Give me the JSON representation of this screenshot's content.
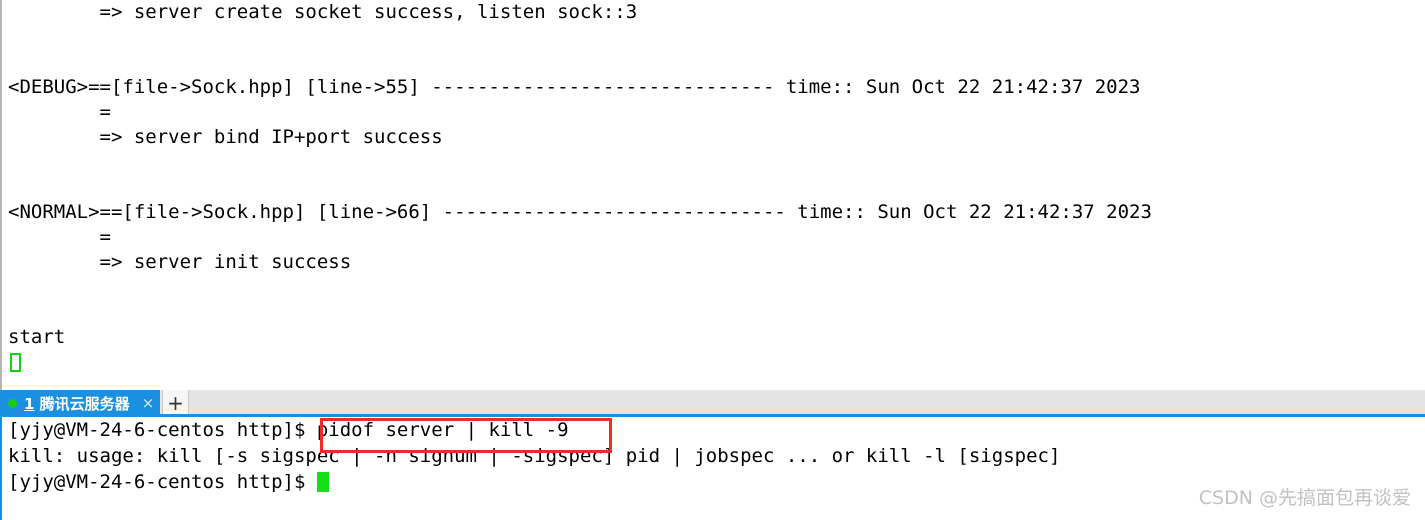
{
  "upper_terminal": {
    "lines": [
      "        => server create socket success, listen sock::3",
      "",
      "",
      "<DEBUG>==[file->Sock.hpp] [line->55] ------------------------------ time:: Sun Oct 22 21:42:37 2023",
      "        =",
      "        => server bind IP+port success",
      "",
      "",
      "<NORMAL>==[file->Sock.hpp] [line->66] ------------------------------ time:: Sun Oct 22 21:42:37 2023",
      "        =",
      "        => server init success",
      "",
      "",
      "start"
    ],
    "cursor": "block-outline-green"
  },
  "tab_bar": {
    "active_tab": {
      "status_dot": "green-connected-dot",
      "index": "1",
      "title": "腾讯云服务器",
      "close_label": "×"
    },
    "new_tab_label": "+"
  },
  "lower_terminal": {
    "prompt": "[yjy@VM-24-6-centos http]$ ",
    "typed_command": "pidof server | kill -9",
    "output_line": "kill: usage: kill [-s sigspec | -n signum | -sigspec] pid | jobspec ... or kill -l [sigspec]",
    "last_prompt": "[yjy@VM-24-6-centos http]$ ",
    "cursor": "block-solid-green"
  },
  "annotation": {
    "highlight_color": "#ee2b24",
    "highlight_target": "pidof server | kill -9"
  },
  "watermark": {
    "text": "CSDN @先搞面包再谈爱"
  },
  "colors": {
    "tab_active_bg": "#1b8fe0",
    "tab_bar_bg": "#e4e4e4",
    "cursor_green": "#17e017",
    "annotation_red": "#ee2b24",
    "terminal_bg": "#ffffff",
    "terminal_fg": "#000000"
  }
}
